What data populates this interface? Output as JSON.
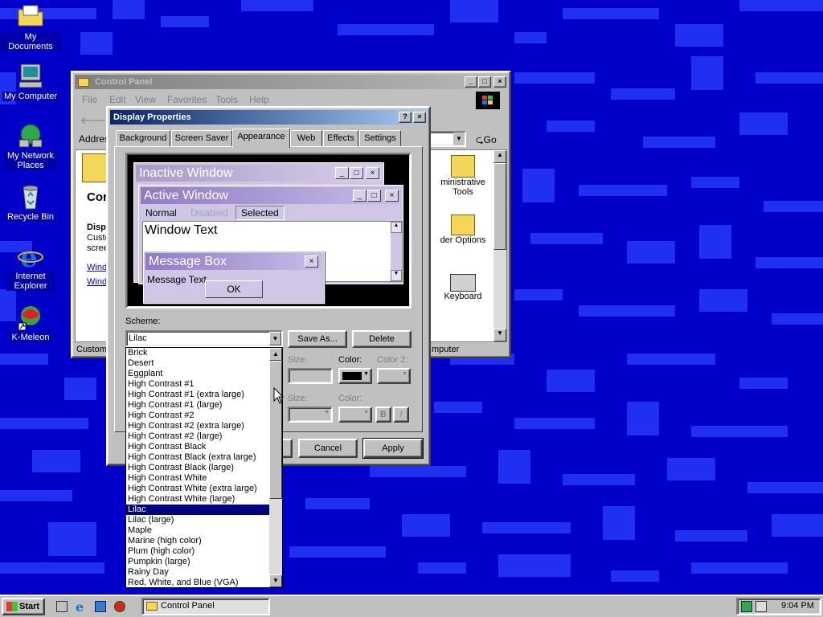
{
  "desktop": {
    "icons": [
      {
        "label": "My Documents"
      },
      {
        "label": "My Computer"
      },
      {
        "label": "My Network Places"
      },
      {
        "label": "Recycle Bin"
      },
      {
        "label": "Internet Explorer"
      },
      {
        "label": "K-Meleon"
      }
    ]
  },
  "control_panel": {
    "title": "Control Panel",
    "menu": [
      "File",
      "Edit",
      "View",
      "Favorites",
      "Tools",
      "Help"
    ],
    "back_label": "Ba",
    "address_label": "Addres",
    "go_label": "Go",
    "side_title": "Cor",
    "side_heading": "Disp",
    "side_text_1": "Custo",
    "side_text_2": "scree",
    "side_link_1": "Wind",
    "side_link_2": "Wind",
    "items": [
      {
        "label": "Administrative Tools",
        "visible": "ministrative\nTools"
      },
      {
        "label": "Folder Options",
        "visible": "der Options"
      },
      {
        "label": "Keyboard",
        "visible": "Keyboard"
      }
    ],
    "status_left": "Customi",
    "status_right": "mputer"
  },
  "display_properties": {
    "title": "Display Properties",
    "tabs": [
      "Background",
      "Screen Saver",
      "Appearance",
      "Web",
      "Effects",
      "Settings"
    ],
    "selected_tab": "Appearance",
    "preview": {
      "inactive_title": "Inactive Window",
      "active_title": "Active Window",
      "menu_normal": "Normal",
      "menu_disabled": "Disabled",
      "menu_selected": "Selected",
      "window_text": "Window Text",
      "msgbox_title": "Message Box",
      "msgbox_text": "Message Text",
      "ok_label": "OK"
    },
    "scheme_label": "Scheme:",
    "scheme_value": "Lilac",
    "save_as_label": "Save As...",
    "delete_label": "Delete",
    "size_label": "Size:",
    "color_label": "Color:",
    "color2_label": "Color 2:",
    "bold_label": "B",
    "italic_label": "I",
    "cancel_label": "Cancel",
    "apply_label": "Apply",
    "scheme_options": [
      "Brick",
      "Desert",
      "Eggplant",
      "High Contrast #1",
      "High Contrast #1 (extra large)",
      "High Contrast #1 (large)",
      "High Contrast #2",
      "High Contrast #2 (extra large)",
      "High Contrast #2 (large)",
      "High Contrast Black",
      "High Contrast Black (extra large)",
      "High Contrast Black (large)",
      "High Contrast White",
      "High Contrast White (extra large)",
      "High Contrast White (large)",
      "Lilac",
      "Lilac (large)",
      "Maple",
      "Marine (high color)",
      "Plum (high color)",
      "Pumpkin (large)",
      "Rainy Day",
      "Red, White, and Blue (VGA)"
    ],
    "selected_option": "Lilac"
  },
  "taskbar": {
    "start_label": "Start",
    "task_label": "Control Panel",
    "clock": "9:04 PM"
  },
  "colors": {
    "desktop": "#0000c8",
    "pattern": "#1e2cf0",
    "lilac_dark": "#8e7cc3",
    "lilac_light": "#c8bce8"
  }
}
